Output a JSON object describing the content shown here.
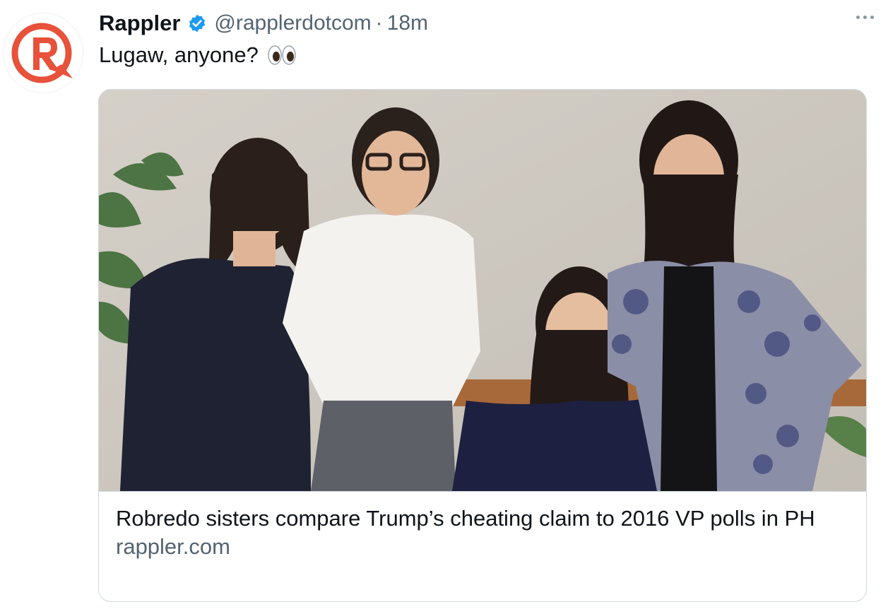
{
  "tweet": {
    "author": {
      "display_name": "Rappler",
      "handle": "@rapplerdotcom",
      "verified": true,
      "avatar_icon": "rappler-logo-icon"
    },
    "separator": "·",
    "time_ago": "18m",
    "text": "Lugaw, anyone?",
    "emoji": "eyes-emoji",
    "more_icon": "more-options-icon"
  },
  "card": {
    "image_description_icon": "photo-four-women",
    "title": "Robredo sisters compare Trump’s cheating claim to 2016 VP polls in PH",
    "domain": "rappler.com"
  },
  "colors": {
    "verified": "#1d9bf0",
    "brand": "#e8513a",
    "muted_text": "#536471"
  }
}
